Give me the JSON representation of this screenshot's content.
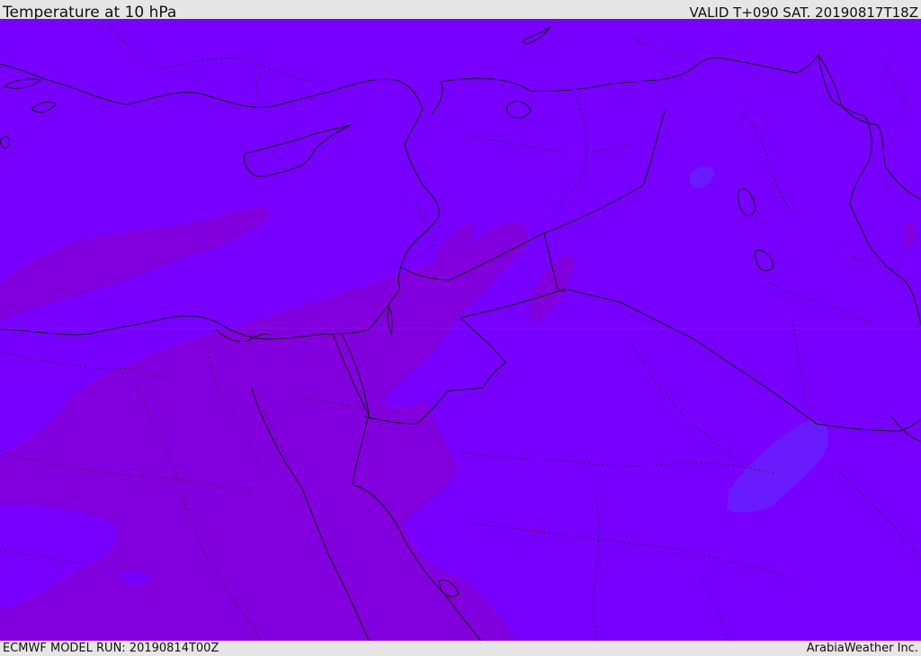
{
  "header": {
    "title": "Temperature at 10 hPa",
    "valid": "VALID T+090 SAT. 20190817T18Z"
  },
  "footer": {
    "model_run": "ECMWF MODEL RUN: 20190814T00Z",
    "credit": "ArabiaWeather Inc."
  },
  "map": {
    "colors": {
      "background": "#7700ff",
      "warm_band": "#8200dd",
      "cool_patch": "#6a1aff",
      "border": "#111111",
      "coast": "#111111"
    }
  }
}
